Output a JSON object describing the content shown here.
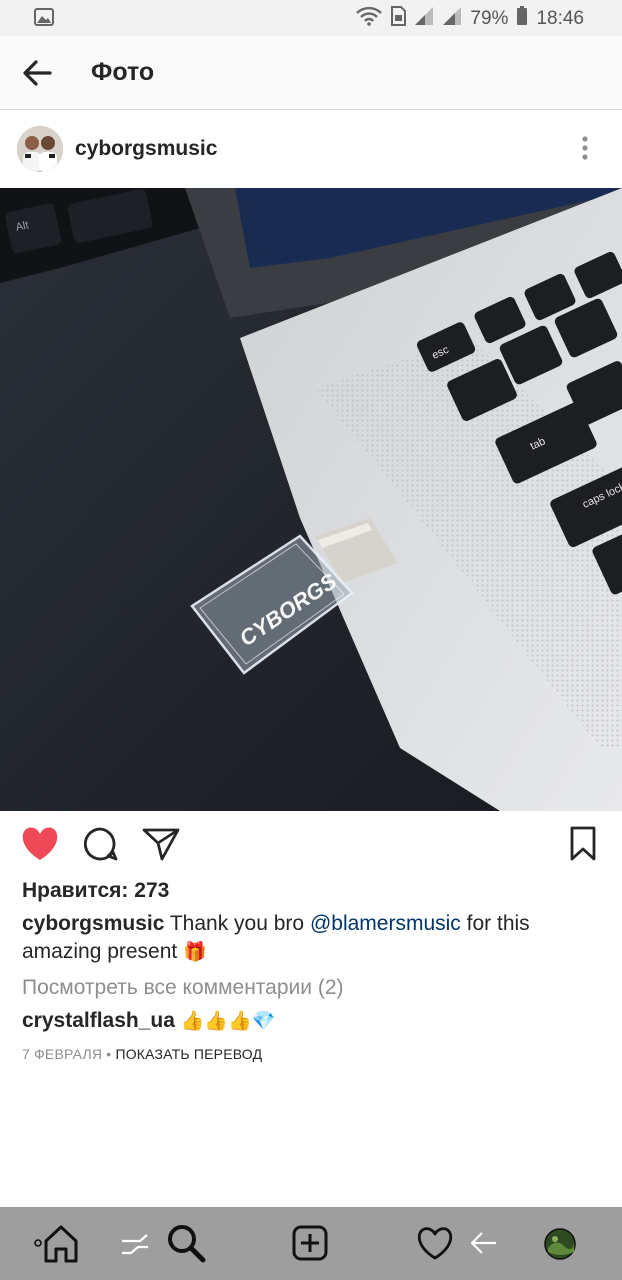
{
  "status": {
    "battery": "79%",
    "time": "18:46"
  },
  "appbar": {
    "title": "Фото"
  },
  "post": {
    "username": "cyborgsmusic",
    "likes_label": "Нравится: 273",
    "caption_author": "cyborgsmusic",
    "caption_text_1": "Thank you bro",
    "caption_mention": "@blamersmusic",
    "caption_text_2": "for this amazing present",
    "caption_emoji": "🎁",
    "view_all_comments": "Посмотреть все комментарии (2)",
    "comment_author": "crystalflash_ua",
    "comment_emojis": "👍👍👍💎",
    "date": "7 ФЕВРАЛЯ",
    "separator": "•",
    "translate": "ПОКАЗАТЬ ПЕРЕВОД",
    "photo_text": {
      "usb_label": "CYBORGS",
      "key_esc": "esc",
      "key_tab": "tab",
      "key_caps": "caps lock",
      "key_alt": "Alt"
    }
  },
  "colors": {
    "like_red": "#ed4956",
    "mention_blue": "#003569",
    "muted": "#8e8e8e",
    "navbar": "#9e9e9e"
  }
}
